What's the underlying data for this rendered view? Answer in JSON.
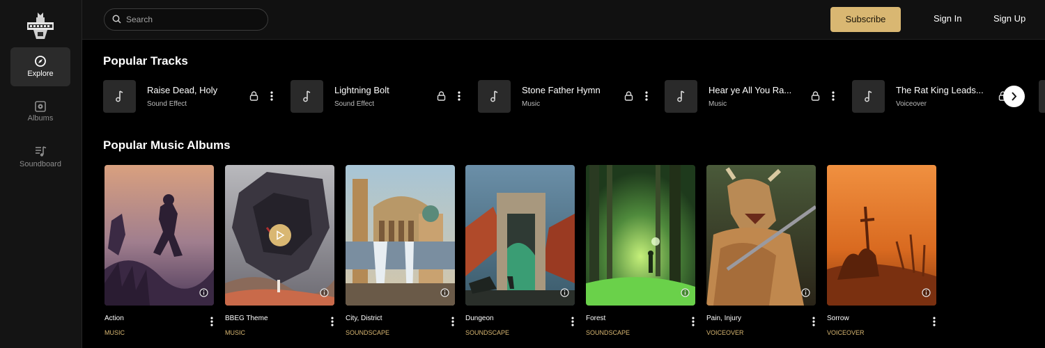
{
  "sidebar": {
    "items": [
      {
        "label": "Explore",
        "icon": "compass-icon",
        "active": true
      },
      {
        "label": "Albums",
        "icon": "album-icon",
        "active": false
      },
      {
        "label": "Soundboard",
        "icon": "soundboard-icon",
        "active": false
      }
    ]
  },
  "header": {
    "search_placeholder": "Search",
    "subscribe_label": "Subscribe",
    "sign_in_label": "Sign In",
    "sign_up_label": "Sign Up"
  },
  "tracks": {
    "heading": "Popular Tracks",
    "items": [
      {
        "name": "Raise Dead, Holy",
        "type": "Sound Effect"
      },
      {
        "name": "Lightning Bolt",
        "type": "Sound Effect"
      },
      {
        "name": "Stone Father Hymn",
        "type": "Music"
      },
      {
        "name": "Hear ye All You Ra...",
        "type": "Music"
      },
      {
        "name": "The Rat King Leads...",
        "type": "Voiceover"
      }
    ]
  },
  "albums": {
    "heading": "Popular Music Albums",
    "items": [
      {
        "name": "Action",
        "category": "MUSIC"
      },
      {
        "name": "BBEG Theme",
        "category": "MUSIC"
      },
      {
        "name": "City, District",
        "category": "SOUNDSCAPE"
      },
      {
        "name": "Dungeon",
        "category": "SOUNDSCAPE"
      },
      {
        "name": "Forest",
        "category": "SOUNDSCAPE"
      },
      {
        "name": "Pain, Injury",
        "category": "VOICEOVER"
      },
      {
        "name": "Sorrow",
        "category": "VOICEOVER"
      }
    ]
  },
  "colors": {
    "accent": "#d9b772",
    "background": "#000000",
    "sidebar": "#141414"
  }
}
